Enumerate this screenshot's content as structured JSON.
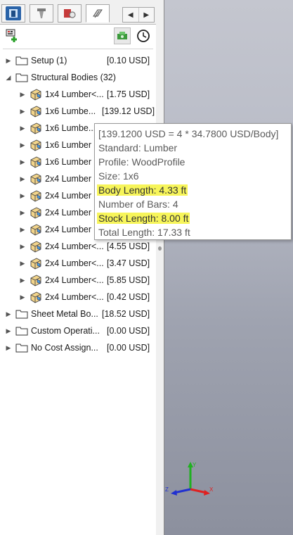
{
  "tabs": [
    {
      "name": "feature-manager-tab",
      "active": false
    },
    {
      "name": "property-manager-tab",
      "active": false
    },
    {
      "name": "configuration-manager-tab",
      "active": false
    },
    {
      "name": "costing-manager-tab",
      "active": true
    }
  ],
  "tree": {
    "setup": {
      "label": "Setup (1)",
      "price": "[0.10 USD]"
    },
    "structural": {
      "label": "Structural Bodies (32)"
    },
    "bodies": [
      {
        "label": "1x4 Lumber<...",
        "price": "[1.75 USD]"
      },
      {
        "label": "1x6 Lumbe...",
        "price": "[139.12 USD]"
      },
      {
        "label": "1x6 Lumbe...",
        "price": ""
      },
      {
        "label": "1x6 Lumber",
        "price": ""
      },
      {
        "label": "1x6 Lumber",
        "price": ""
      },
      {
        "label": "2x4 Lumber",
        "price": ""
      },
      {
        "label": "2x4 Lumber",
        "price": ""
      },
      {
        "label": "2x4 Lumber",
        "price": ""
      },
      {
        "label": "2x4 Lumber",
        "price": ""
      },
      {
        "label": "2x4 Lumber<...",
        "price": "[4.55 USD]"
      },
      {
        "label": "2x4 Lumber<...",
        "price": "[3.47 USD]"
      },
      {
        "label": "2x4 Lumber<...",
        "price": "[5.85 USD]"
      },
      {
        "label": "2x4 Lumber<...",
        "price": "[0.42 USD]"
      }
    ],
    "sheet_metal": {
      "label": "Sheet Metal Bo...",
      "price": "[18.52 USD]"
    },
    "custom_ops": {
      "label": "Custom Operati...",
      "price": "[0.00 USD]"
    },
    "no_cost": {
      "label": "No Cost Assign...",
      "price": "[0.00 USD]"
    }
  },
  "tooltip": {
    "lines": [
      "[139.1200 USD = 4  * 34.7800 USD/Body]",
      "Standard: Lumber",
      "Profile: WoodProfile",
      "Size: 1x6",
      "Body Length: 4.33 ft",
      "Number of Bars: 4",
      "Stock Length: 8.00 ft",
      "Total Length: 17.33 ft"
    ],
    "highlighted": [
      false,
      false,
      false,
      false,
      true,
      false,
      true,
      false
    ]
  },
  "triad": {
    "x_label": "X",
    "y_label": "Y",
    "z_label": "Z"
  },
  "colors": {
    "highlight": "#f7f55a",
    "triad_x": "#e02020",
    "triad_y": "#20b020",
    "triad_z": "#2030d0"
  }
}
